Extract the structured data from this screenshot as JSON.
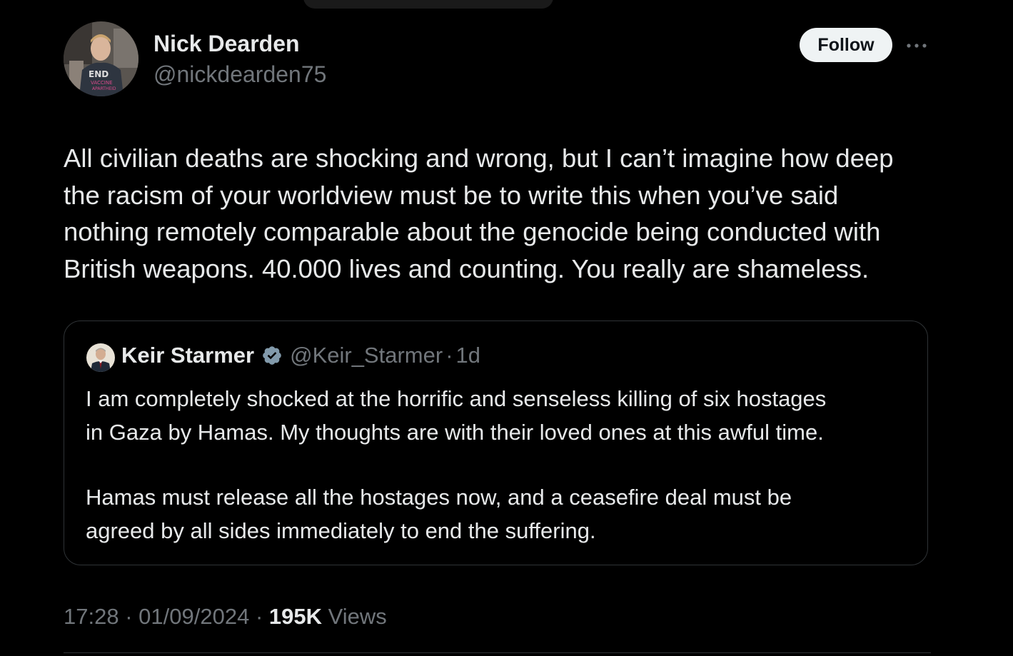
{
  "author": {
    "name": "Nick Dearden",
    "handle": "@nickdearden75",
    "avatar_icon": "profile-photo-avatar"
  },
  "actions": {
    "follow_label": "Follow",
    "more_icon": "more-horizontal-icon"
  },
  "tweet": {
    "text_lines": [
      "All civilian deaths are shocking and wrong, but I can’t imagine how deep",
      "the racism of your worldview must be to write this when you’ve said",
      "nothing remotely comparable about the genocide being conducted with",
      "British weapons. 40.000 lives and counting. You really are shameless."
    ]
  },
  "quote": {
    "name": "Keir Starmer",
    "handle": "@Keir_Starmer",
    "separator": "·",
    "time": "1d",
    "verified_icon": "verified-badge-icon",
    "paragraph1": [
      "I am completely shocked at the horrific and senseless killing of six hostages",
      "in Gaza by Hamas. My thoughts are with their loved ones at this awful time."
    ],
    "paragraph2": [
      "Hamas must release all the hostages now, and a ceasefire deal must be",
      "agreed by all sides immediately to end the suffering."
    ]
  },
  "meta": {
    "time": "17:28",
    "separator": "·",
    "date": "01/09/2024",
    "views_count": "195K",
    "views_label": "Views"
  },
  "colors": {
    "background": "#000000",
    "text_primary": "#e7e9ea",
    "text_secondary": "#71767b",
    "border": "#2f3336",
    "verified_badge": "#829aab",
    "follow_button_bg": "#eff3f4"
  }
}
